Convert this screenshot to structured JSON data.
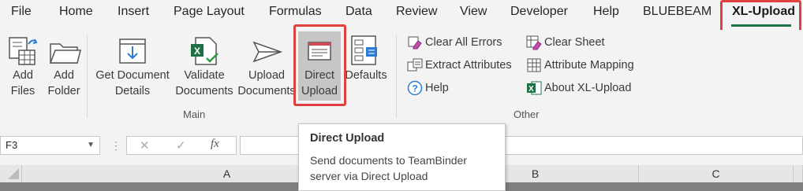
{
  "tabs": [
    "File",
    "Home",
    "Insert",
    "Page Layout",
    "Formulas",
    "Data",
    "Review",
    "View",
    "Developer",
    "Help",
    "BLUEBEAM",
    "XL-Upload"
  ],
  "ribbon": {
    "main_group": {
      "label": "Main",
      "buttons": [
        {
          "line1": "Add",
          "line2": "Files"
        },
        {
          "line1": "Add",
          "line2": "Folder"
        },
        {
          "line1": "Get Document",
          "line2": "Details"
        },
        {
          "line1": "Validate",
          "line2": "Documents"
        },
        {
          "line1": "Upload",
          "line2": "Documents"
        },
        {
          "line1": "Direct",
          "line2": "Upload"
        },
        {
          "line1": "Defaults",
          "line2": ""
        }
      ]
    },
    "other_group": {
      "label": "Other",
      "left": [
        "Clear All Errors",
        "Extract Attributes",
        "Help"
      ],
      "right": [
        "Clear Sheet",
        "Attribute Mapping",
        "About XL-Upload"
      ]
    }
  },
  "formula_bar": {
    "name_box": "F3",
    "cancel_glyph": "✕",
    "enter_glyph": "✓",
    "fx_glyph": "fx"
  },
  "columns": [
    "A",
    "B",
    "C"
  ],
  "tooltip": {
    "title": "Direct Upload",
    "description": "Send documents to TeamBinder server via Direct Upload"
  },
  "colors": {
    "accent": "#217346",
    "highlight": "#e0413f"
  }
}
